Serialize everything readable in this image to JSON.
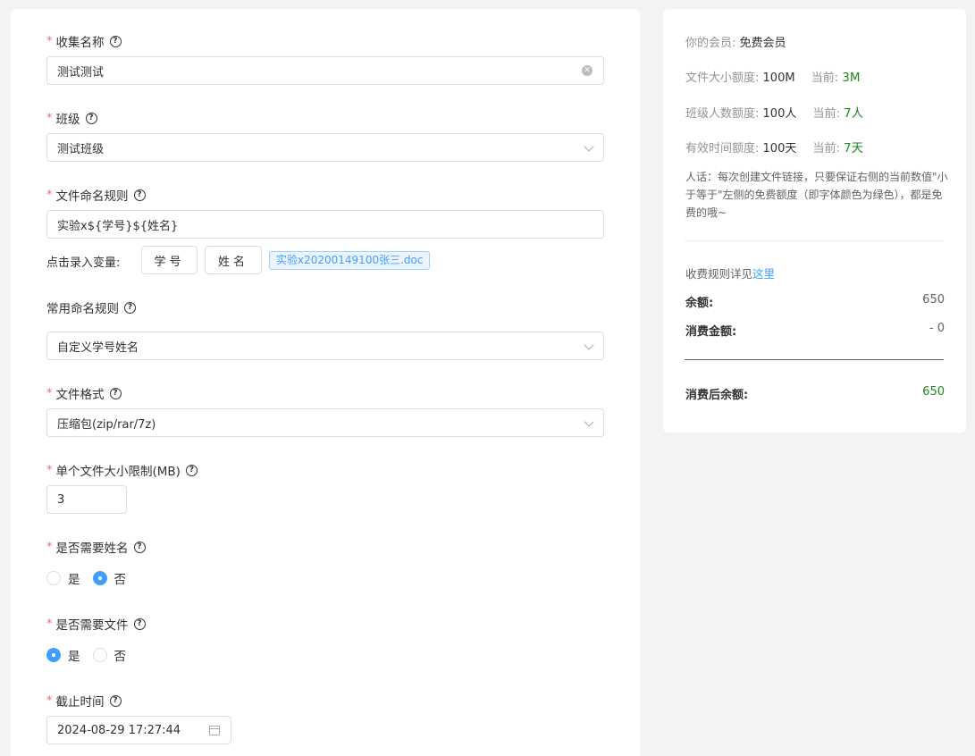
{
  "form": {
    "collection_name": {
      "label": "收集名称",
      "value": "测试测试"
    },
    "class": {
      "label": "班级",
      "value": "测试班级"
    },
    "naming_rule": {
      "label": "文件命名规则",
      "value": "实验x${学号}${姓名}",
      "var_label": "点击录入变量:",
      "btn_student_id": "学号",
      "btn_name": "姓名",
      "preview": "实验x20200149100张三.doc"
    },
    "common_rule": {
      "label": "常用命名规则",
      "value": "自定义学号姓名"
    },
    "file_format": {
      "label": "文件格式",
      "value": "压缩包(zip/rar/7z)"
    },
    "size_limit": {
      "label": "单个文件大小限制(MB)",
      "value": "3"
    },
    "need_name": {
      "label": "是否需要姓名",
      "yes": "是",
      "no": "否",
      "selected": "否"
    },
    "need_file": {
      "label": "是否需要文件",
      "yes": "是",
      "no": "否",
      "selected": "是"
    },
    "deadline": {
      "label": "截止时间",
      "value": "2024-08-29 17:27:44"
    }
  },
  "sidebar": {
    "membership_label": "你的会员:",
    "membership_value": "免费会员",
    "file_size_label": "文件大小额度:",
    "file_size_value": "100M",
    "file_size_cur_label": "当前:",
    "file_size_cur": "3M",
    "class_size_label": "班级人数额度:",
    "class_size_value": "100人",
    "class_size_cur_label": "当前:",
    "class_size_cur": "7人",
    "valid_time_label": "有效时间额度:",
    "valid_time_value": "100天",
    "valid_time_cur_label": "当前:",
    "valid_time_cur": "7天",
    "note": "人话：每次创建文件链接，只要保证右侧的当前数值\"小于等于\"左侧的免费额度（即字体颜色为绿色），都是免费的哦~",
    "fee_rule_text": "收费规则详见",
    "fee_rule_link": "这里",
    "balance_label": "余额:",
    "balance_value": "650",
    "cost_label": "消费金额:",
    "cost_value": "- 0",
    "after_label": "消费后余额:",
    "after_value": "650"
  },
  "colors": {
    "required": "#f56c6c",
    "primary": "#409eff",
    "green": "#1d8a1d"
  }
}
